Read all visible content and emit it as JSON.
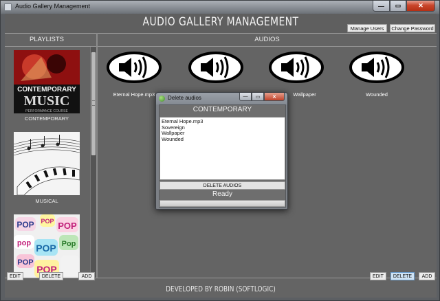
{
  "window": {
    "title": "Audio Gallery Management",
    "controls": {
      "minimize": "—",
      "maximize": "▭",
      "close": "✕"
    }
  },
  "header": {
    "title": "AUDIO GALLERY MANAGEMENT",
    "manage_users": "Manage Users",
    "change_password": "Change Password"
  },
  "sections": {
    "playlists": "PLAYLISTS",
    "audios": "AUDIOS"
  },
  "playlists": [
    {
      "label": "CONTEMPORARY",
      "cover_text_1": "CONTEMPORARY",
      "cover_text_2": "MUSIC",
      "cover_text_3": "PERFORMANCE COURSE"
    },
    {
      "label": "MUSICAL"
    },
    {
      "label": "",
      "cover_words": [
        "POP",
        "POP",
        "POP",
        "pop",
        "POP",
        "Pop",
        "POP",
        "POP"
      ]
    }
  ],
  "audios": [
    {
      "label": "Eternal Hope.mp3"
    },
    {
      "label": ""
    },
    {
      "label": "Wallpaper"
    },
    {
      "label": "Wounded"
    }
  ],
  "left_buttons": {
    "edit": "EDIT",
    "delete": "DELETE",
    "add": "ADD"
  },
  "right_buttons": {
    "edit": "EDIT",
    "delete": "DELETE",
    "add": "ADD"
  },
  "footer": "DEVELOPED BY ROBIN (SOFTLOGIC)",
  "dialog": {
    "title": "Delete audios",
    "heading": "CONTEMPORARY",
    "items": [
      "Eternal Hope.mp3",
      "Sovereign",
      "Wallpaper",
      "Wounded"
    ],
    "delete_button": "DELETE AUDIOS",
    "status": "Ready"
  },
  "colors": {
    "background": "#646464",
    "text_light": "#f0f0f0",
    "button": "#ececec",
    "active_button": "#cfe3f4"
  }
}
